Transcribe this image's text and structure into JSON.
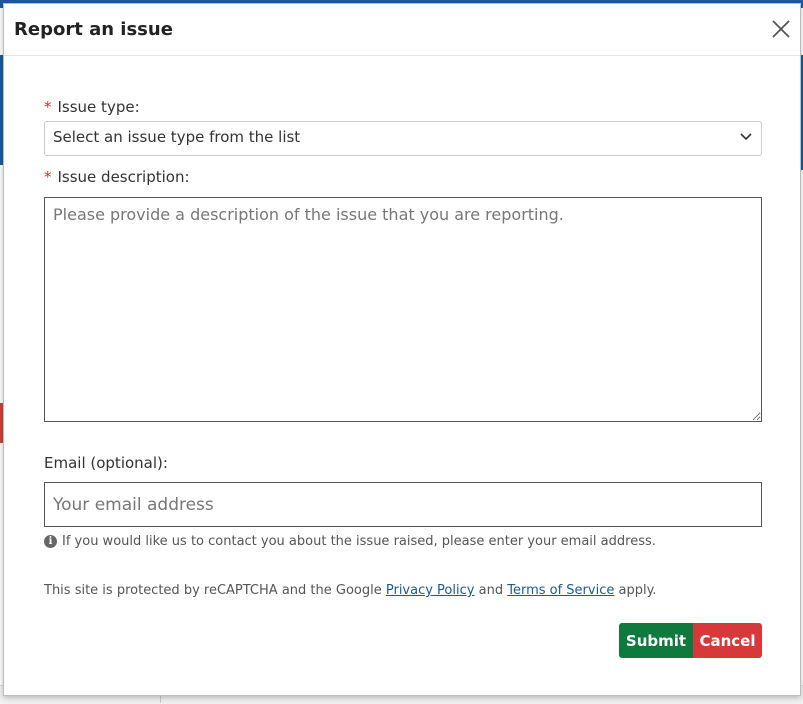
{
  "dialog": {
    "title": "Report an issue"
  },
  "form": {
    "required_mark": "*",
    "issue_type": {
      "label": "Issue type:",
      "selected": "Select an issue type from the list"
    },
    "issue_description": {
      "label": "Issue description:",
      "placeholder": "Please provide a description of the issue that you are reporting."
    },
    "email": {
      "label": "Email (optional):",
      "placeholder": "Your email address",
      "help": "If you would like us to contact you about the issue raised, please enter your email address."
    }
  },
  "recaptcha": {
    "prefix": "This site is protected by reCAPTCHA and the Google",
    "privacy_link": "Privacy Policy",
    "and": "and",
    "terms_link": "Terms of Service",
    "suffix": "apply."
  },
  "buttons": {
    "submit": "Submit",
    "cancel": "Cancel"
  },
  "colors": {
    "submit": "#0f7a3e",
    "cancel": "#d7393b",
    "required": "#d9302b",
    "link": "#1a5a96"
  }
}
